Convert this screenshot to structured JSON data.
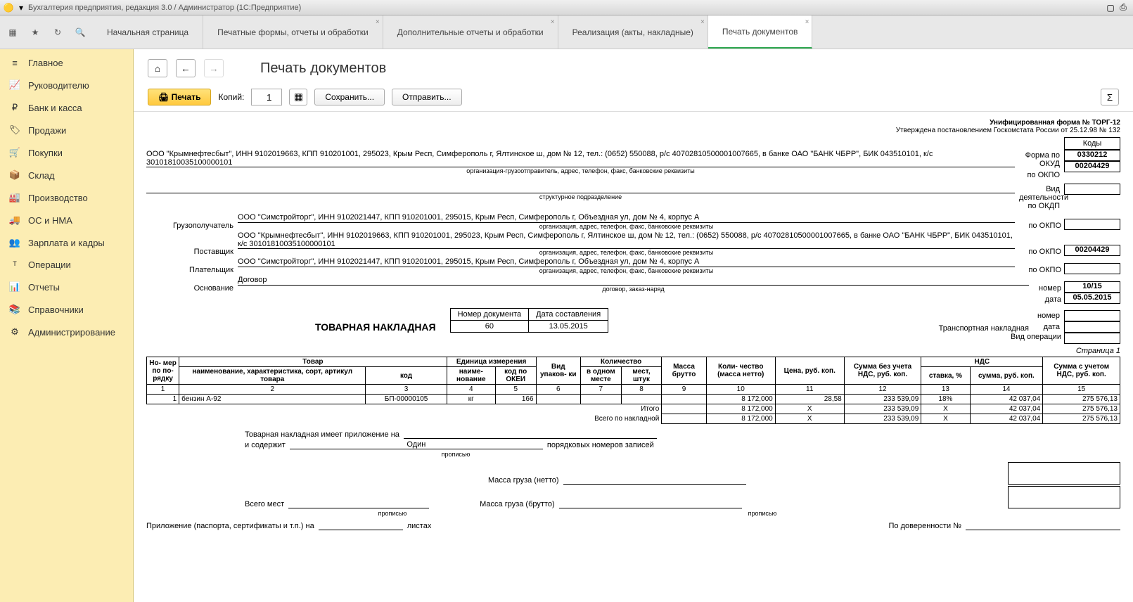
{
  "window": {
    "title": "Бухгалтерия предприятия, редакция 3.0 / Администратор (1С:Предприятие)"
  },
  "tabs": [
    {
      "label": "Начальная страница"
    },
    {
      "label": "Печатные формы, отчеты и обработки"
    },
    {
      "label": "Дополнительные отчеты и обработки"
    },
    {
      "label": "Реализация (акты, накладные)"
    },
    {
      "label": "Печать документов"
    }
  ],
  "sidebar": [
    {
      "label": "Главное"
    },
    {
      "label": "Руководителю"
    },
    {
      "label": "Банк и касса"
    },
    {
      "label": "Продажи"
    },
    {
      "label": "Покупки"
    },
    {
      "label": "Склад"
    },
    {
      "label": "Производство"
    },
    {
      "label": "ОС и НМА"
    },
    {
      "label": "Зарплата и кадры"
    },
    {
      "label": "Операции"
    },
    {
      "label": "Отчеты"
    },
    {
      "label": "Справочники"
    },
    {
      "label": "Администрирование"
    }
  ],
  "page": {
    "title": "Печать документов"
  },
  "actions": {
    "print": "Печать",
    "copies_label": "Копий:",
    "copies_value": "1",
    "save": "Сохранить...",
    "send": "Отправить..."
  },
  "doc": {
    "form_line1": "Унифицированная форма № ТОРГ-12",
    "form_line2": "Утверждена постановлением Госкомстата России от 25.12.98 № 132",
    "codes_header": "Коды",
    "okud_label": "Форма по ОКУД",
    "okud": "0330212",
    "okpo_label": "по ОКПО",
    "okpo_sender": "00204429",
    "activity_label": "Вид деятельности по ОКДП",
    "sender_text": "ООО \"Крымнефтесбыт\", ИНН 9102019663, КПП 910201001, 295023, Крым Респ, Симферополь г, Ялтинское ш, дом № 12, тел.: (0652) 550088, р/с 40702810500001007665, в банке ОАО \"БАНК ЧБРР\", БИК 043510101, к/с 30101810035100000101",
    "sender_caption": "организация-грузоотправитель, адрес, телефон, факс, банковские реквизиты",
    "subdiv_caption": "структурное подразделение",
    "consignee_label": "Грузополучатель",
    "consignee_text": "ООО \"Симстройторг\", ИНН 9102021447, КПП 910201001, 295015, Крым Респ, Симферополь г, Объездная ул, дом № 4, корпус А",
    "consignee_caption": "организация, адрес, телефон, факс, банковские реквизиты",
    "supplier_label": "Поставщик",
    "supplier_text": "ООО \"Крымнефтесбыт\", ИНН 9102019663, КПП 910201001, 295023, Крым Респ, Симферополь г, Ялтинское ш, дом № 12, тел.: (0652) 550088, р/с 40702810500001007665, в банке ОАО \"БАНК ЧБРР\", БИК 043510101, к/с 30101810035100000101",
    "supplier_caption": "организация, адрес, телефон, факс, банковские реквизиты",
    "supplier_okpo": "00204429",
    "payer_label": "Плательщик",
    "payer_text": "ООО \"Симстройторг\", ИНН 9102021447, КПП 910201001, 295015, Крым Респ, Симферополь г, Объездная ул, дом № 4, корпус А",
    "payer_caption": "организация, адрес, телефон, факс, банковские реквизиты",
    "basis_label": "Основание",
    "basis_text": "Договор",
    "basis_caption": "договор, заказ-наряд",
    "basis_num_label": "номер",
    "basis_num": "10/15",
    "basis_date_label": "дата",
    "basis_date": "05.05.2015",
    "tn_label": "Транспортная накладная",
    "tn_num_label": "номер",
    "tn_date_label": "дата",
    "op_label": "Вид операции",
    "title": "ТОВАРНАЯ НАКЛАДНАЯ",
    "docnum_h1": "Номер документа",
    "docnum_h2": "Дата составления",
    "docnum": "60",
    "docdate": "13.05.2015",
    "page_note": "Страница 1",
    "headers": {
      "num": "Но-\nмер\nпо по-\nрядку",
      "goods": "Товар",
      "goods_name": "наименование, характеристика, сорт, артикул товара",
      "goods_code": "код",
      "unit": "Единица измерения",
      "unit_name": "наиме-\nнование",
      "unit_okei": "код по ОКЕИ",
      "pack": "Вид упаков-\nки",
      "qty": "Количество",
      "qty_in": "в одном месте",
      "qty_places": "мест, штук",
      "mass": "Масса брутто",
      "qty_net": "Коли-\nчество (масса нетто)",
      "price": "Цена, руб. коп.",
      "sum_novat": "Сумма без учета НДС, руб. коп.",
      "vat": "НДС",
      "vat_rate": "ставка, %",
      "vat_sum": "сумма, руб. коп.",
      "sum_vat": "Сумма с учетом НДС, руб. коп."
    },
    "colnums": [
      "1",
      "2",
      "3",
      "4",
      "5",
      "6",
      "7",
      "8",
      "9",
      "10",
      "11",
      "12",
      "13",
      "14",
      "15"
    ],
    "row": {
      "n": "1",
      "name": "бензин А-92",
      "code": "БП-00000105",
      "unit": "кг",
      "okei": "166",
      "pack": "",
      "qin": "",
      "qplaces": "",
      "mass": "",
      "qnet": "8 172,000",
      "price": "28,58",
      "sumnovat": "233 539,09",
      "vatrate": "18%",
      "vatsum": "42 037,04",
      "sumvat": "275 576,13"
    },
    "totals_label": "Итого",
    "grand_label": "Всего по накладной",
    "totals": {
      "qnet": "8 172,000",
      "price": "X",
      "sumnovat": "233 539,09",
      "vatrate": "X",
      "vatsum": "42 037,04",
      "sumvat": "275 576,13"
    },
    "grand": {
      "qnet": "8 172,000",
      "price": "X",
      "sumnovat": "233 539,09",
      "vatrate": "X",
      "vatsum": "42 037,04",
      "sumvat": "275 576,13"
    },
    "footer": {
      "attach1": "Товарная накладная имеет приложение на",
      "attach2": "и содержит",
      "attach2_val": "Один",
      "attach2_suffix": "порядковых номеров записей",
      "propis": "прописью",
      "mass_net": "Масса груза (нетто)",
      "total_places": "Всего мест",
      "mass_gross": "Масса груза (брутто)",
      "attach3": "Приложение (паспорта, сертификаты и т.п.) на",
      "sheets": "листах",
      "proxy": "По доверенности №"
    }
  }
}
